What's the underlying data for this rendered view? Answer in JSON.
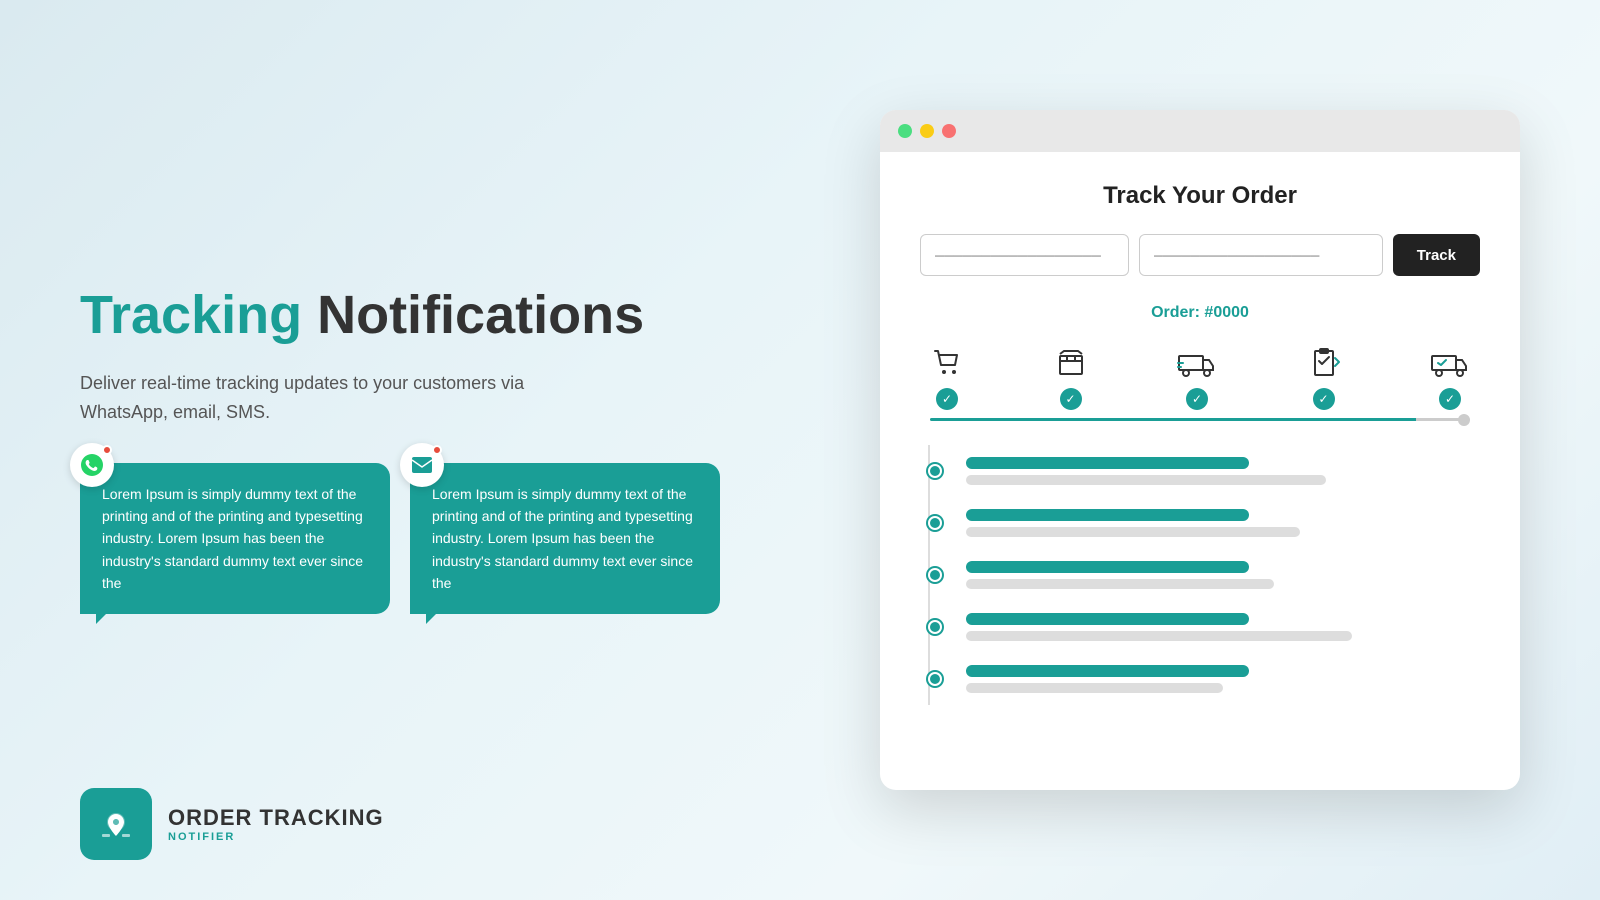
{
  "page": {
    "background": "linear-gradient(135deg, #daeaf0 0%, #e8f4f8 40%, #f0f8fa 70%, #e0eef5 100%)"
  },
  "left": {
    "headline_teal": "Tracking",
    "headline_rest": " Notifications",
    "subtitle": "Deliver real-time tracking updates to your customers via WhatsApp, email, SMS.",
    "bubble1": {
      "icon": "whatsapp",
      "text": "Lorem Ipsum is simply dummy text of the printing and of the printing and typesetting industry. Lorem Ipsum has been the industry's standard dummy text ever since the"
    },
    "bubble2": {
      "icon": "email",
      "text": "Lorem Ipsum is simply dummy text of the printing and of the printing and typesetting industry. Lorem Ipsum has been the industry's standard dummy text ever since the"
    },
    "brand": {
      "name": "ORDER TRACKING",
      "sub": "NOTIFIER"
    }
  },
  "browser": {
    "title": "Track Your Order",
    "input1_placeholder": "──────────────────",
    "input2_placeholder": "──────────────────",
    "track_button": "Track",
    "order_label": "Order: #0000",
    "steps": [
      {
        "icon": "🛒",
        "checked": true
      },
      {
        "icon": "📦",
        "checked": true
      },
      {
        "icon": "🚚",
        "checked": true
      },
      {
        "icon": "📋",
        "checked": true
      },
      {
        "icon": "🚛",
        "checked": true
      }
    ],
    "timeline": [
      {
        "primary_width": "55%",
        "secondary_width": "70%"
      },
      {
        "primary_width": "55%",
        "secondary_width": "65%"
      },
      {
        "primary_width": "55%",
        "secondary_width": "60%"
      },
      {
        "primary_width": "55%",
        "secondary_width": "75%"
      },
      {
        "primary_width": "55%",
        "secondary_width": "50%"
      }
    ]
  }
}
